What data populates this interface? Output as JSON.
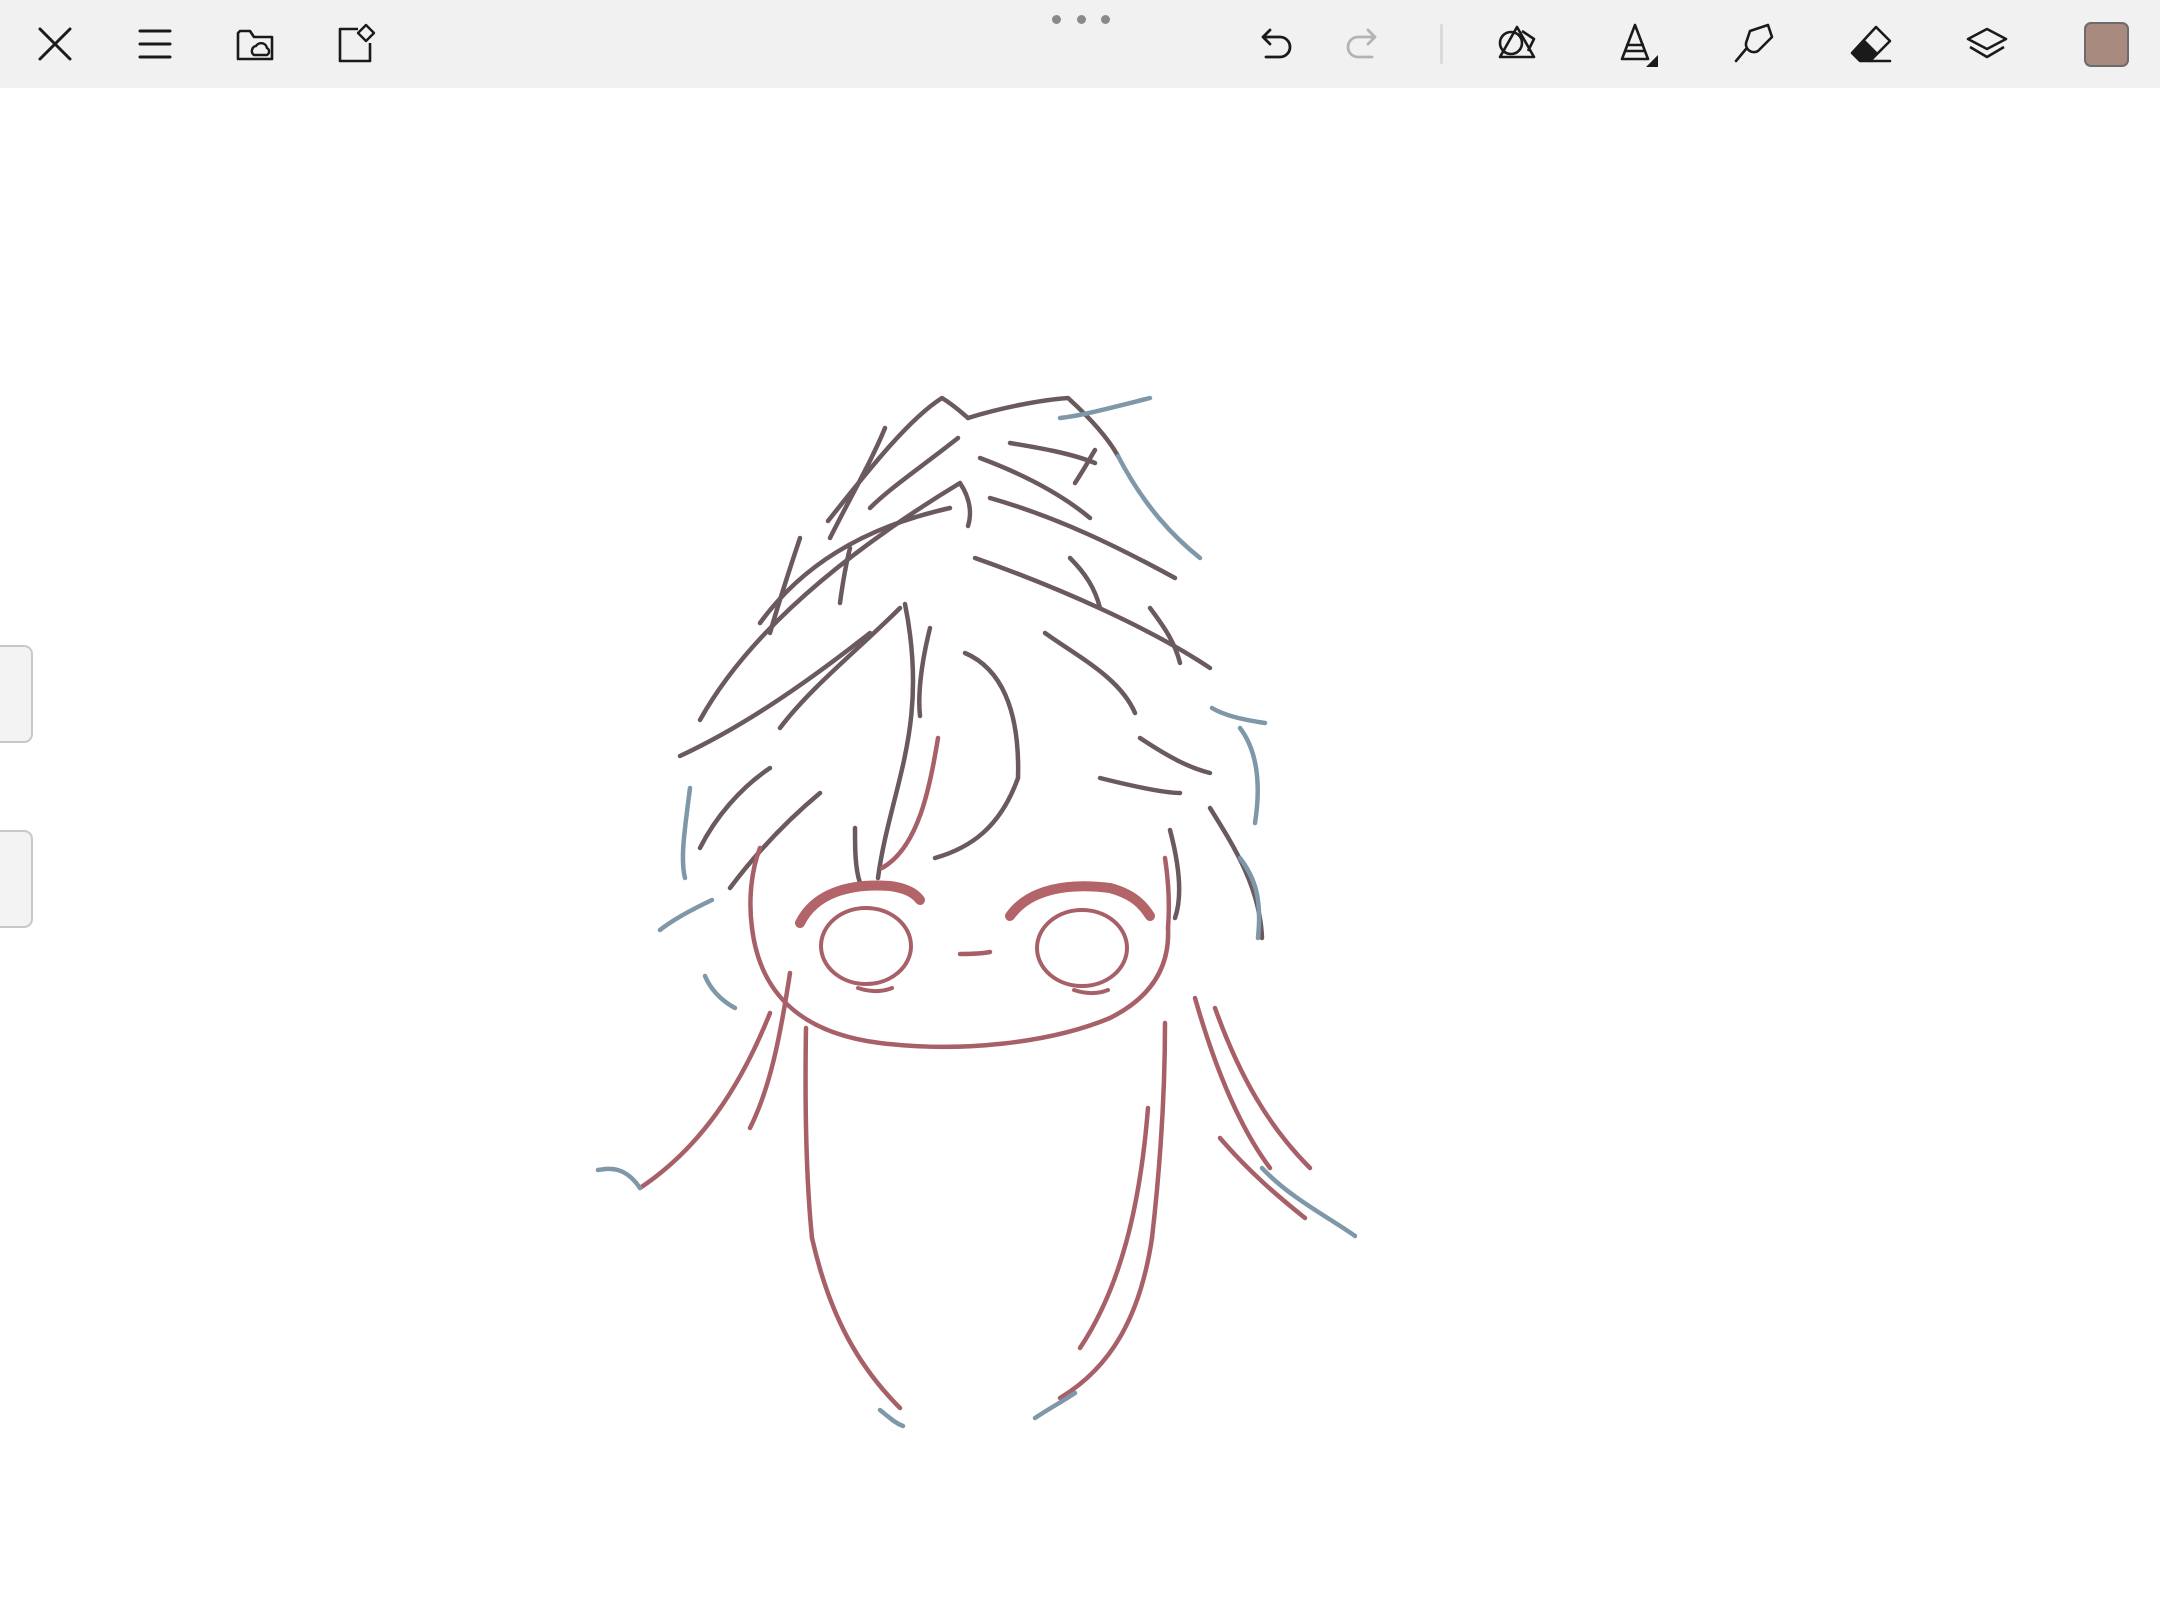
{
  "app": {
    "toolbar": {
      "buttons": [
        {
          "id": "close",
          "icon": "close-icon"
        },
        {
          "id": "menu",
          "icon": "hamburger-menu-icon"
        },
        {
          "id": "gallery",
          "icon": "folder-cloud-icon"
        },
        {
          "id": "canvas-settings",
          "icon": "canvas-gear-icon"
        },
        {
          "id": "undo",
          "icon": "undo-arrow-icon",
          "enabled": true
        },
        {
          "id": "redo",
          "icon": "redo-arrow-icon",
          "enabled": false
        },
        {
          "id": "shapes",
          "icon": "shapes-icon"
        },
        {
          "id": "brush",
          "icon": "pen-nib-icon",
          "selected": true
        },
        {
          "id": "smudge",
          "icon": "smudge-finger-icon"
        },
        {
          "id": "eraser",
          "icon": "eraser-icon"
        },
        {
          "id": "layers",
          "icon": "layers-stack-icon"
        }
      ],
      "current_color": "#a88a7e"
    },
    "canvas": {
      "background": "#ffffff",
      "ink_colors": {
        "dark": "#6a5a5e",
        "red": "#a86068",
        "blue": "#7e98aa",
        "lash": "#b26468"
      }
    }
  }
}
